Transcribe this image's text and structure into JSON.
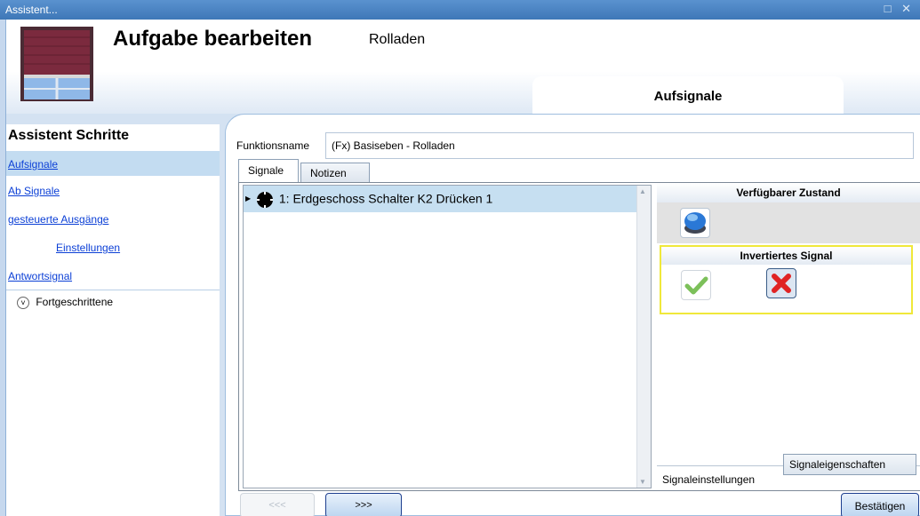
{
  "window": {
    "title": "Assistent...",
    "controls": "□ ✕"
  },
  "header": {
    "title": "Aufgabe bearbeiten",
    "subtitle": "Rolladen",
    "current_step": "Aufsignale"
  },
  "sidebar": {
    "title": "Assistent Schritte",
    "steps": [
      {
        "label": "Aufsignale"
      },
      {
        "label": "Ab Signale"
      },
      {
        "label": "gesteuerte Ausgänge"
      },
      {
        "label": "Einstellungen"
      },
      {
        "label": "Antwortsignal"
      }
    ],
    "advanced": "Fortgeschrittene"
  },
  "form": {
    "name_label": "Funktionsname",
    "name_value": "(Fx) Basiseben - Rolladen"
  },
  "tabs": [
    {
      "label": "Signale"
    },
    {
      "label": "Notizen"
    }
  ],
  "signals": [
    {
      "label": "1: Erdgeschoss Schalter K2 Drücken 1"
    }
  ],
  "right_panel": {
    "state_header": "Verfügbarer Zustand",
    "inverted_header": "Invertiertes Signal",
    "bottom_tabs": [
      {
        "label": "Signaleinstellungen"
      },
      {
        "label": "Signaleigenschaften"
      }
    ]
  },
  "buttons": {
    "prev": "<<<",
    "next": ">>>",
    "confirm": "Bestätigen"
  },
  "icons": {
    "window": "roller-shutter-icon",
    "state": "blue-push-button-icon",
    "check": "check-icon",
    "cross": "cross-icon"
  }
}
